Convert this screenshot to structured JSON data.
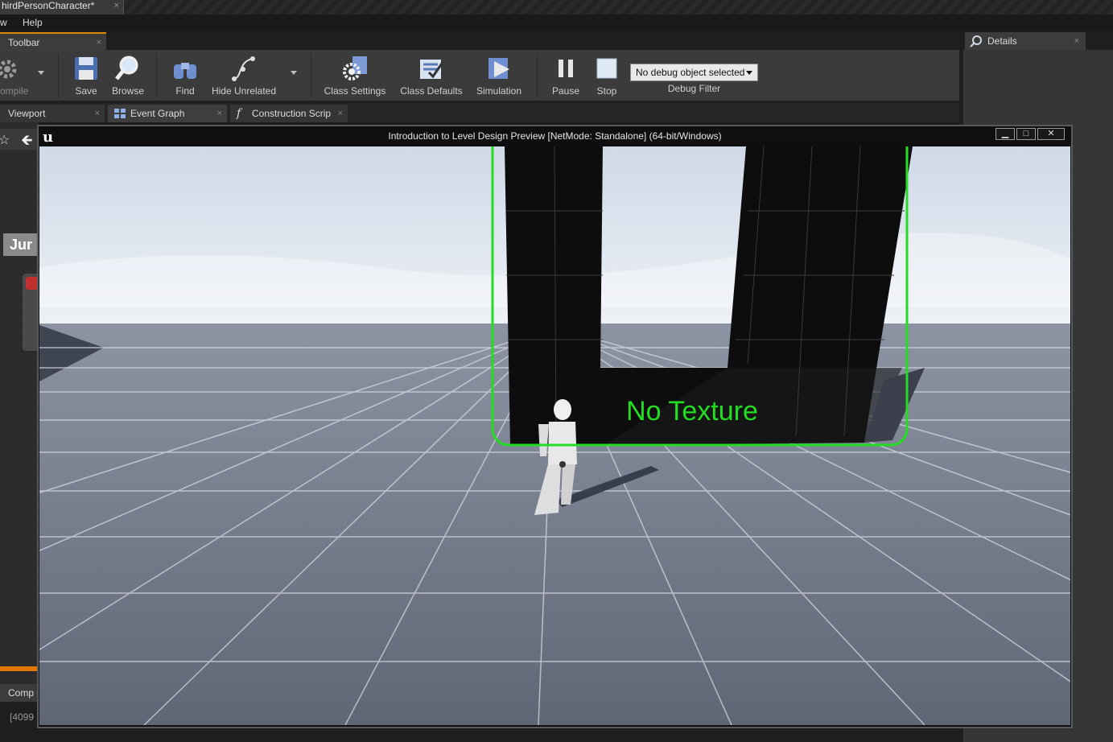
{
  "document_tab": {
    "title": "hirdPersonCharacter*",
    "close": "×"
  },
  "menu": {
    "items": [
      "w",
      "Help"
    ]
  },
  "toolbar_panel": {
    "tab_label": "Toolbar",
    "close": "×"
  },
  "toolbar": {
    "compile_label": "ompile",
    "save_label": "Save",
    "browse_label": "Browse",
    "find_label": "Find",
    "hide_unrelated_label": "Hide Unrelated",
    "class_settings_label": "Class Settings",
    "class_defaults_label": "Class Defaults",
    "simulation_label": "Simulation",
    "pause_label": "Pause",
    "stop_label": "Stop",
    "debug_select_value": "No debug object selected",
    "debug_filter_label": "Debug Filter"
  },
  "details_panel": {
    "tab_label": "Details",
    "close": "×"
  },
  "editor_tabs": [
    {
      "label": "Viewport",
      "close": "×"
    },
    {
      "label": "Event Graph",
      "close": "×"
    },
    {
      "label": "Construction Scrip",
      "close": "×"
    }
  ],
  "graph": {
    "node_label": "Jur",
    "components_tab": "Comp",
    "log_text": "[4099"
  },
  "preview": {
    "title": "Introduction to Level Design Preview [NetMode: Standalone]  (64-bit/Windows)",
    "minimize": "▁",
    "maximize": "□",
    "close": "✕"
  },
  "annotation": {
    "text": "No Texture",
    "color": "#22dd22"
  },
  "colors": {
    "accent_orange": "#e07800",
    "annotation_green": "#22dd22"
  }
}
